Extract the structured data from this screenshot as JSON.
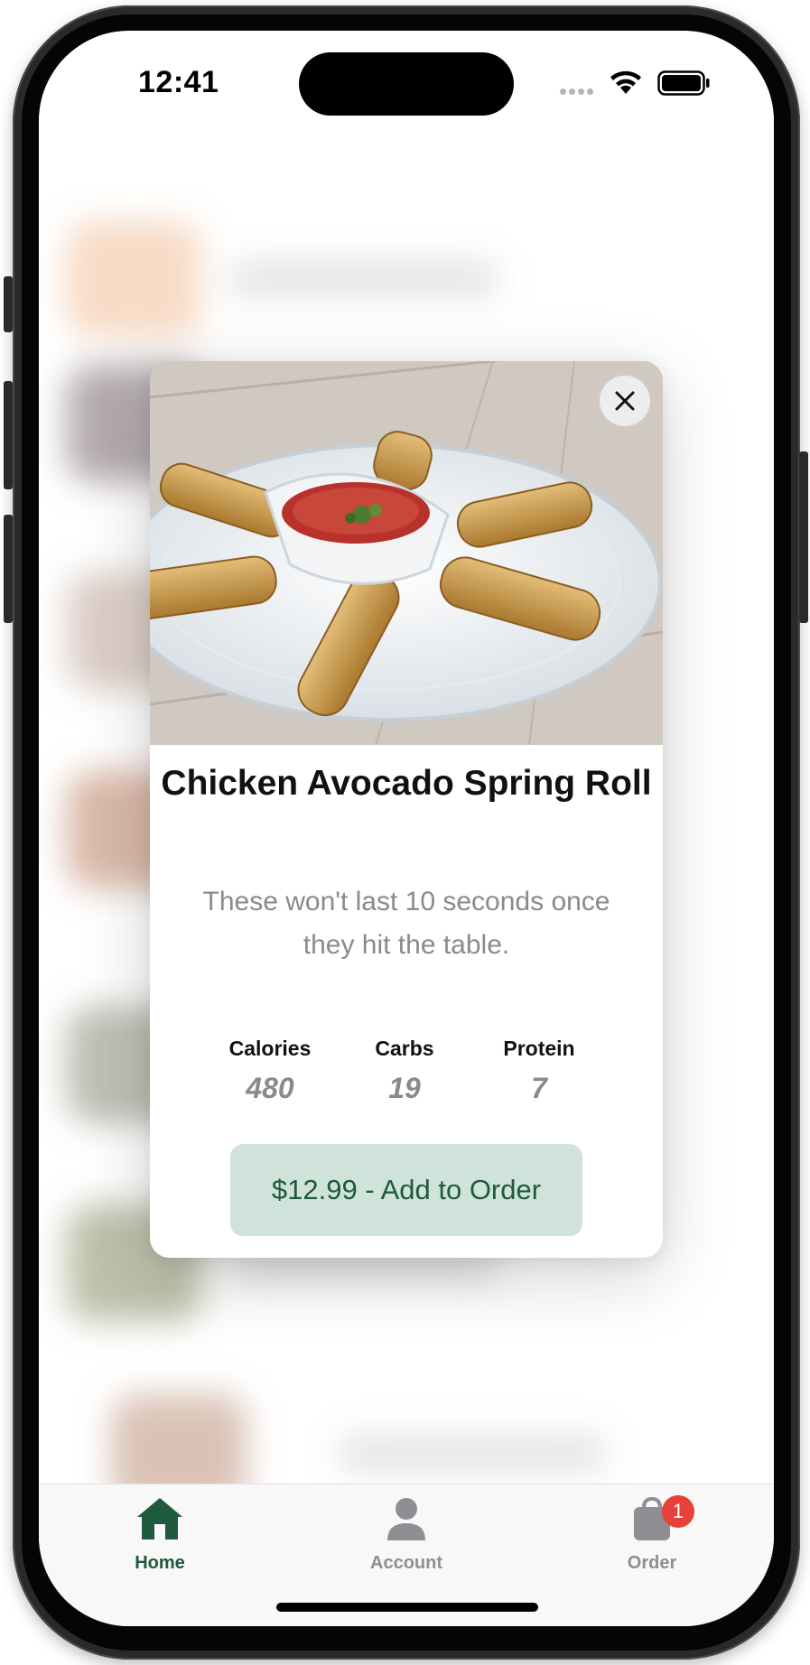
{
  "status_bar": {
    "time": "12:41"
  },
  "modal": {
    "image_alt": "Plate of chicken avocado spring rolls with salsa dip",
    "close_label": "×",
    "title": "Chicken Avocado Spring Roll",
    "description": "These won't last 10 seconds once they hit the table.",
    "nutrition": [
      {
        "label": "Calories",
        "value": "480"
      },
      {
        "label": "Carbs",
        "value": "19"
      },
      {
        "label": "Protein",
        "value": "7"
      }
    ],
    "add_button_label": "$12.99 - Add to Order"
  },
  "tabbar": {
    "items": [
      {
        "label": "Home",
        "icon": "house-icon",
        "active": true
      },
      {
        "label": "Account",
        "icon": "person-icon",
        "active": false
      },
      {
        "label": "Order",
        "icon": "bag-icon",
        "active": false,
        "badge": "1"
      }
    ]
  },
  "colors": {
    "brand_green": "#1f5a3c",
    "button_bg": "#d0e3db",
    "tab_inactive": "#8e8e93",
    "badge_red": "#e8403b"
  }
}
